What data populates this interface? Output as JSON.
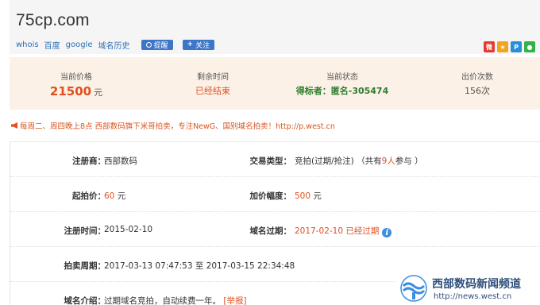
{
  "header": {
    "domain": "75cp.com",
    "links": [
      "whois",
      "百度",
      "google",
      "域名历史"
    ],
    "remind_label": "提醒",
    "follow_label": "关注"
  },
  "share_icons": [
    {
      "name": "weibo-icon",
      "glyph": "微",
      "color": "#e33c2f"
    },
    {
      "name": "qzone-icon",
      "glyph": "★",
      "color": "#f2a51b"
    },
    {
      "name": "tencent-weibo-icon",
      "glyph": "P",
      "color": "#2a8fd6"
    },
    {
      "name": "wechat-icon",
      "glyph": "●",
      "color": "#33b14a"
    }
  ],
  "stats": {
    "current_price_label": "当前价格",
    "current_price": "21500",
    "currency": "元",
    "time_left_label": "剩余时间",
    "time_left": "已经结束",
    "status_label": "当前状态",
    "status": "得标者：匿名-305474",
    "bids_label": "出价次数",
    "bids": "156次"
  },
  "notice": "每周二、周四晚上8点 西部数码旗下米哥拍卖，专注NewG、国别域名拍卖！http://p.west.cn",
  "details": {
    "registrar_label": "注册商：",
    "registrar": "西部数码",
    "trade_type_label": "交易类型：",
    "trade_type_prefix": "竞拍(过期/抢注) （共有",
    "participants": "9人",
    "trade_type_suffix": "参与 ）",
    "start_price_label": "起拍价：",
    "start_price": "60",
    "start_price_unit": "元",
    "increment_label": "加价幅度：",
    "increment": "500",
    "increment_unit": "元",
    "reg_time_label": "注册时间：",
    "reg_time": "2015-02-10",
    "expiry_label": "域名过期：",
    "expiry": "2017-02-10 已经过期",
    "auction_period_label": "拍卖周期：",
    "auction_period": "2017-03-13 07:47:53 至 2017-03-15 22:34:48",
    "intro_label": "域名介绍：",
    "intro": "过期域名竞拍，自动续费一年。",
    "report_label": "[举报]"
  },
  "watermark": {
    "name": "西部数码新闻频道",
    "url": "http://news.west.cn"
  }
}
